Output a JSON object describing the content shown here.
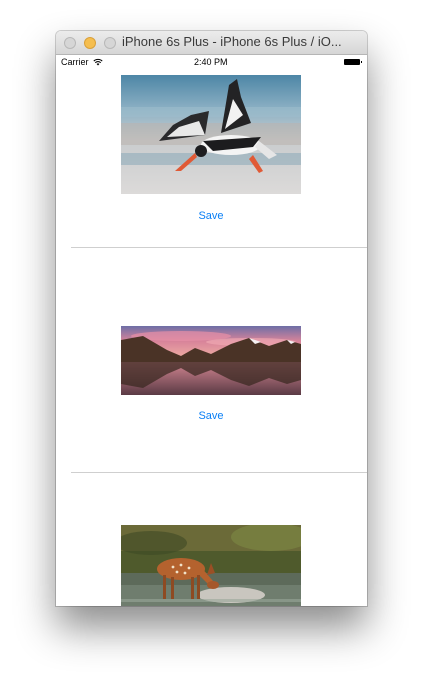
{
  "window": {
    "title": "iPhone 6s Plus - iPhone 6s Plus / iO..."
  },
  "status_bar": {
    "carrier": "Carrier",
    "time": "2:40 PM"
  },
  "rows": [
    {
      "image": "bird-skimmer-photo",
      "save_label": "Save"
    },
    {
      "image": "mountain-lake-photo",
      "save_label": "Save"
    },
    {
      "image": "fawn-deer-photo"
    }
  ]
}
